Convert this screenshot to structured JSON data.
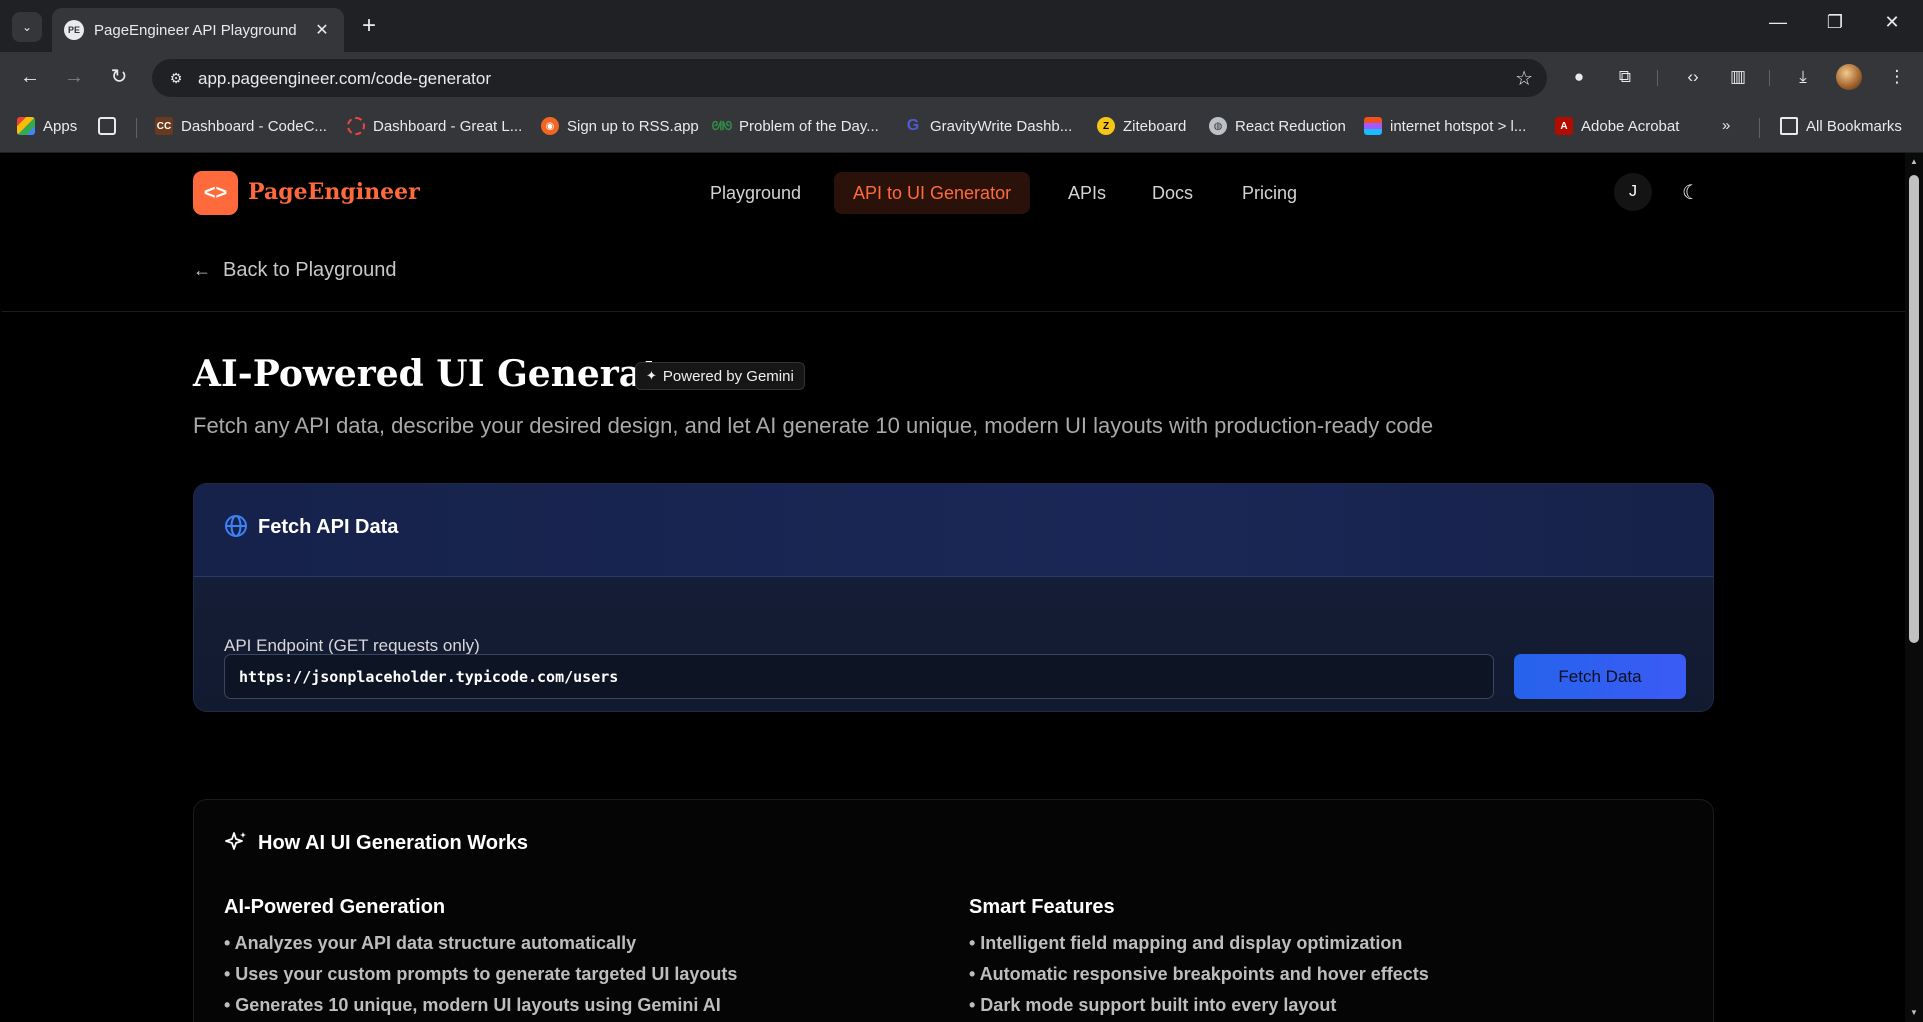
{
  "browser": {
    "tab_title": "PageEngineer API Playground",
    "tab_favicon": "PE",
    "url": "app.pageengineer.com/code-generator",
    "bookmarks": [
      {
        "label": "Apps",
        "icon": "apps-grid-icon"
      },
      {
        "label": "Dashboard - CodeC...",
        "icon": "codec-icon"
      },
      {
        "label": "Dashboard - Great L...",
        "icon": "greatlearning-icon"
      },
      {
        "label": "Sign up to RSS.app",
        "icon": "rss-icon"
      },
      {
        "label": "Problem of the Day...",
        "icon": "gfg-icon"
      },
      {
        "label": "GravityWrite Dashb...",
        "icon": "gravitywrite-icon"
      },
      {
        "label": "Ziteboard",
        "icon": "ziteboard-icon"
      },
      {
        "label": "React Reduction",
        "icon": "globe-icon"
      },
      {
        "label": "internet hotspot > l...",
        "icon": "figma-icon"
      },
      {
        "label": "Adobe Acrobat",
        "icon": "acrobat-icon"
      }
    ],
    "all_bookmarks": "All Bookmarks"
  },
  "header": {
    "logo_mark": "<>",
    "logo_text": "PageEngineer",
    "nav": [
      {
        "label": "Playground",
        "active": false
      },
      {
        "label": "API to UI Generator",
        "active": true
      },
      {
        "label": "APIs",
        "active": false
      },
      {
        "label": "Docs",
        "active": false
      },
      {
        "label": "Pricing",
        "active": false
      }
    ],
    "avatar_initial": "J"
  },
  "back_link": "Back to Playground",
  "hero": {
    "title": "AI-Powered UI Generator",
    "badge": "Powered by Gemini",
    "subtitle": "Fetch any API data, describe your desired design, and let AI generate 10 unique, modern UI layouts with production-ready code"
  },
  "fetch_card": {
    "title": "Fetch API Data",
    "field_label": "API Endpoint (GET requests only)",
    "endpoint_value": "https://jsonplaceholder.typicode.com/users",
    "button": "Fetch Data"
  },
  "how_card": {
    "title": "How AI UI Generation Works",
    "columns": [
      {
        "title": "AI-Powered Generation",
        "items": [
          "• Analyzes your API data structure automatically",
          "• Uses your custom prompts to generate targeted UI layouts",
          "• Generates 10 unique, modern UI layouts using Gemini AI"
        ]
      },
      {
        "title": "Smart Features",
        "items": [
          "• Intelligent field mapping and display optimization",
          "• Automatic responsive breakpoints and hover effects",
          "• Dark mode support built into every layout"
        ]
      }
    ]
  },
  "colors": {
    "brand": "#ff6a3d",
    "primary_button": "#2563eb",
    "page_bg": "#000000"
  }
}
